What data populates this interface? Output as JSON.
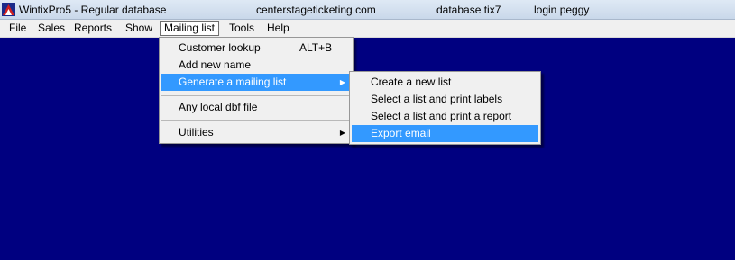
{
  "titlebar": {
    "app": "WintixPro5 - Regular database",
    "site": "centerstageticketing.com",
    "database": "database tix7",
    "login": "login peggy"
  },
  "menubar": [
    "File",
    "Sales",
    "Reports",
    "Show",
    "Mailing list",
    "Tools",
    "Help"
  ],
  "mailing_menu": {
    "customer_lookup": "Customer lookup",
    "customer_lookup_shortcut": "ALT+B",
    "add_new_name": "Add new name",
    "generate_mailing_list": "Generate a mailing list",
    "any_local_dbf": "Any local dbf file",
    "utilities": "Utilities"
  },
  "generate_submenu": {
    "create_new_list": "Create a new list",
    "print_labels": "Select a list and print labels",
    "print_report": "Select a list and print a report",
    "export_email": "Export email"
  },
  "colors": {
    "desktop": "#000080",
    "highlight": "#3399ff"
  }
}
